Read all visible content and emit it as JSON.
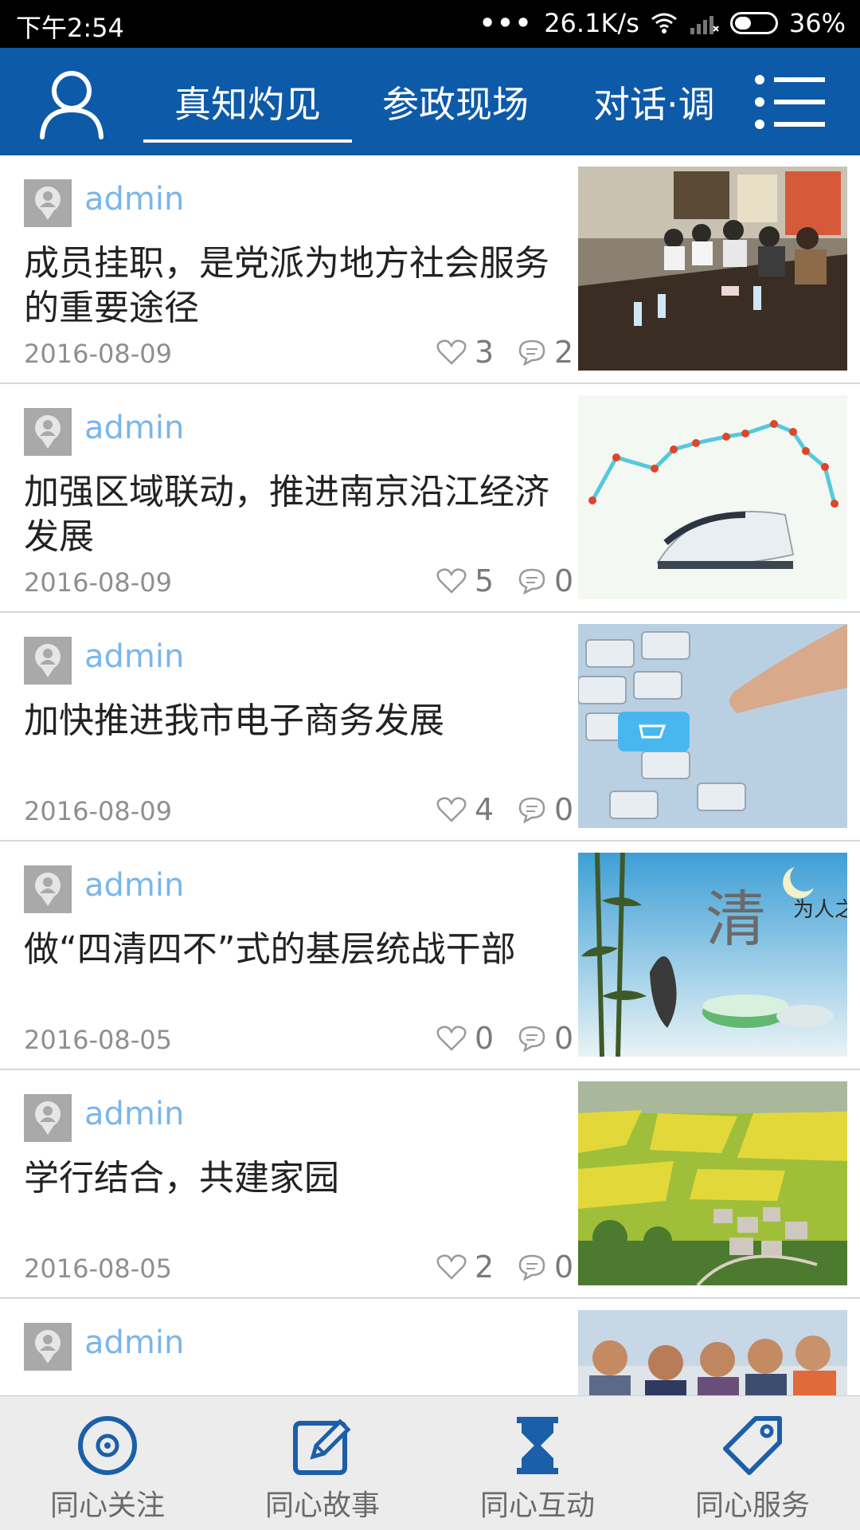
{
  "status_bar": {
    "time": "下午2:54",
    "network_speed": "26.1K/s",
    "battery": "36%"
  },
  "top_nav": {
    "tabs": [
      {
        "label": "真知灼见",
        "active": true
      },
      {
        "label": "参政现场",
        "active": false
      },
      {
        "label": "对话·调",
        "active": false
      }
    ]
  },
  "articles": [
    {
      "author": "admin",
      "title": "成员挂职，是党派为地方社会服务的重要途径",
      "date": "2016-08-09",
      "likes": "3",
      "comments": "2",
      "image": "meeting-photo"
    },
    {
      "author": "admin",
      "title": "加强区域联动，推进南京沿江经济发展",
      "date": "2016-08-09",
      "likes": "5",
      "comments": "0",
      "image": "train-route-map"
    },
    {
      "author": "admin",
      "title": "加快推进我市电子商务发展",
      "date": "2016-08-09",
      "likes": "4",
      "comments": "0",
      "image": "keyboard-cart-photo"
    },
    {
      "author": "admin",
      "title": "做“四清四不”式的基层统战干部",
      "date": "2016-08-05",
      "likes": "0",
      "comments": "0",
      "image": "bamboo-tea-painting"
    },
    {
      "author": "admin",
      "title": "学行结合，共建家园",
      "date": "2016-08-05",
      "likes": "2",
      "comments": "0",
      "image": "village-landscape-photo"
    },
    {
      "author": "admin",
      "title": "",
      "date": "",
      "likes": "",
      "comments": "",
      "image": "group-photo"
    }
  ],
  "bottom_nav": {
    "items": [
      {
        "label": "同心关注",
        "icon": "target-icon"
      },
      {
        "label": "同心故事",
        "icon": "edit-icon"
      },
      {
        "label": "同心互动",
        "icon": "hourglass-icon"
      },
      {
        "label": "同心服务",
        "icon": "tag-icon"
      }
    ]
  },
  "colors": {
    "header_bg": "#0d5aa9",
    "author": "#7ab6ea",
    "bottom_icon": "#1b5fa8"
  }
}
